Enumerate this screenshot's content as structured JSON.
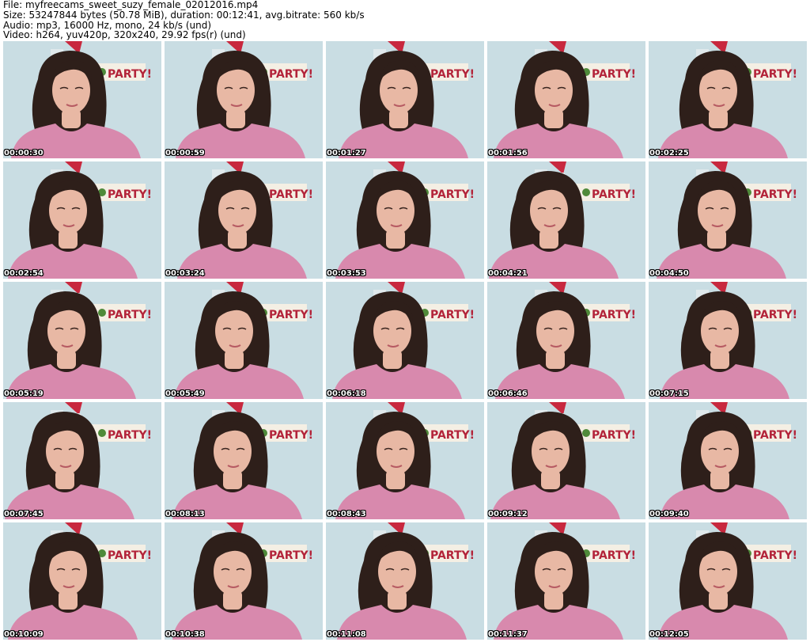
{
  "header": {
    "file_line": "File: myfreecams_sweet_suzy_female_02012016.mp4",
    "size_line": "Size: 53247844 bytes (50.78 MiB), duration: 00:12:41, avg.bitrate: 560 kb/s",
    "audio_line": "Audio: mp3, 16000 Hz, mono, 24 kb/s (und)",
    "video_line": "Video: h264, yuv420p, 320x240, 29.92 fps(r) (und)"
  },
  "banner_text": "PARTY!",
  "colors": {
    "wall": "#c9dde3",
    "hair": "#2e1f1a",
    "skin": "#e8b8a4",
    "shirt": "#d889ad",
    "banner_bg": "#f4efe4",
    "banner_text": "#b3243a",
    "santa_red": "#c8283e"
  },
  "thumbnails": [
    {
      "timestamp": "00:00:30"
    },
    {
      "timestamp": "00:00:59"
    },
    {
      "timestamp": "00:01:27"
    },
    {
      "timestamp": "00:01:56"
    },
    {
      "timestamp": "00:02:25"
    },
    {
      "timestamp": "00:02:54"
    },
    {
      "timestamp": "00:03:24"
    },
    {
      "timestamp": "00:03:53"
    },
    {
      "timestamp": "00:04:21"
    },
    {
      "timestamp": "00:04:50"
    },
    {
      "timestamp": "00:05:19"
    },
    {
      "timestamp": "00:05:49"
    },
    {
      "timestamp": "00:06:18"
    },
    {
      "timestamp": "00:06:46"
    },
    {
      "timestamp": "00:07:15"
    },
    {
      "timestamp": "00:07:45"
    },
    {
      "timestamp": "00:08:13"
    },
    {
      "timestamp": "00:08:43"
    },
    {
      "timestamp": "00:09:12"
    },
    {
      "timestamp": "00:09:40"
    },
    {
      "timestamp": "00:10:09"
    },
    {
      "timestamp": "00:10:38"
    },
    {
      "timestamp": "00:11:08"
    },
    {
      "timestamp": "00:11:37"
    },
    {
      "timestamp": "00:12:05"
    }
  ]
}
